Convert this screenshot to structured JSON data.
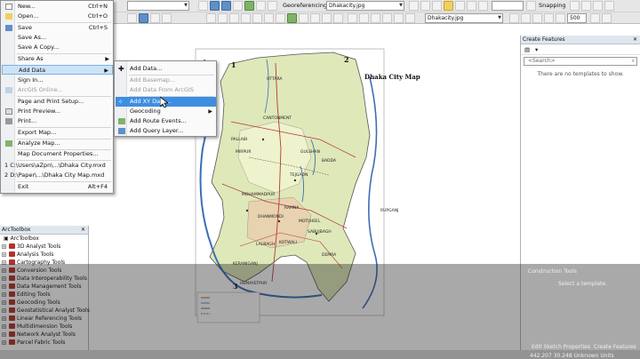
{
  "file_menu": {
    "items": [
      {
        "label": "New...",
        "shortcut": "Ctrl+N"
      },
      {
        "label": "Open...",
        "shortcut": "Ctrl+O"
      },
      {
        "label": "Save",
        "shortcut": "Ctrl+S"
      },
      {
        "label": "Save As...",
        "shortcut": ""
      },
      {
        "label": "Save A Copy...",
        "shortcut": ""
      },
      {
        "label": "Share As",
        "shortcut": ""
      },
      {
        "label": "Add Data",
        "shortcut": ""
      },
      {
        "label": "Sign In...",
        "shortcut": ""
      },
      {
        "label": "ArcGIS Online...",
        "shortcut": ""
      },
      {
        "label": "Page and Print Setup...",
        "shortcut": ""
      },
      {
        "label": "Print Preview...",
        "shortcut": ""
      },
      {
        "label": "Print...",
        "shortcut": ""
      },
      {
        "label": "Export Map...",
        "shortcut": ""
      },
      {
        "label": "Analyze Map...",
        "shortcut": ""
      },
      {
        "label": "Map Document Properties...",
        "shortcut": ""
      },
      {
        "label": "1 C:\\Users\\aZpn\\...\\Dhaka City.mxd",
        "shortcut": ""
      },
      {
        "label": "2 D:\\Paper\\...\\Dhaka City Map.mxd",
        "shortcut": ""
      },
      {
        "label": "Exit",
        "shortcut": "Alt+F4"
      }
    ]
  },
  "add_data_menu": {
    "items": [
      {
        "label": "Add Data..."
      },
      {
        "label": "Add Basemap..."
      },
      {
        "label": "Add Data From ArcGIS Online..."
      },
      {
        "label": "Add XY Data..."
      },
      {
        "label": "Geocoding"
      },
      {
        "label": "Add Route Events..."
      },
      {
        "label": "Add Query Layer..."
      }
    ]
  },
  "toolbar": {
    "georeferencing_label": "Georeferencing",
    "layer_combo": "Dhakacity.jpg",
    "layer_combo2": "Dhakacity.jpg",
    "snapping_label": "Snapping",
    "zoom_value": "500",
    "scale_value": ""
  },
  "map": {
    "title": "Dhaka City Map",
    "corner_1": "1",
    "corner_2": "2",
    "corner_3": "3",
    "places": [
      "UTTARA",
      "PALLABI",
      "MIRPUR",
      "CANTONMENT",
      "GULSHAN",
      "BADDA",
      "TEJGAON",
      "MOHAMMADPUR",
      "DHANMONDI",
      "RAMNA",
      "MOTIJHEEL",
      "SABUJBAGH",
      "LALBAGH",
      "KOTWALI",
      "DEMRA",
      "KERANIGANJ",
      "RUPGANJ",
      "HEMAYETPUR"
    ]
  },
  "toolbox": {
    "title": "ArcToolbox",
    "root": "ArcToolbox",
    "tools": [
      "3D Analyst Tools",
      "Analysis Tools",
      "Cartography Tools",
      "Conversion Tools",
      "Data Interoperability Tools",
      "Data Management Tools",
      "Editing Tools",
      "Geocoding Tools",
      "Geostatistical Analyst Tools",
      "Linear Referencing Tools",
      "Multidimension Tools",
      "Network Analyst Tools",
      "Parcel Fabric Tools"
    ]
  },
  "create_features": {
    "title": "Create Features",
    "search_placeholder": "<Search>",
    "empty_message": "There are no templates to show.",
    "construction_tools": "Construction Tools",
    "select_template": "Select a template.",
    "edit_sketch": "Edit Sketch Properties",
    "create_features_tab": "Create Features"
  },
  "status": {
    "coordinates": "442.207 30.248 Unknown Units"
  },
  "colors": {
    "map_fill": "#dfe8b9",
    "rivers": "#3b6fb6",
    "roads": "#b23a3a",
    "highlight": "#3e8ee0"
  }
}
